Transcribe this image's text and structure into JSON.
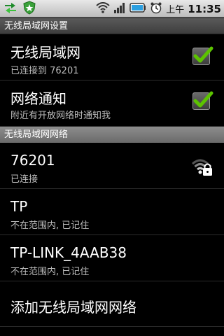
{
  "statusbar": {
    "ampm": "上午",
    "time": "11:35",
    "icons": [
      "usb-debug-icon",
      "shield-icon",
      "wifi-signal-icon",
      "cell-signal-icon",
      "battery-icon",
      "alarm-icon"
    ]
  },
  "titlebar": {
    "title": "无线局域网设置"
  },
  "settings": {
    "wifi": {
      "title": "无线局域网",
      "summary": "已连接到 76201",
      "checked": true
    },
    "notify": {
      "title": "网络通知",
      "summary": "附近有开放网络时通知我",
      "checked": true
    }
  },
  "networks_header": "无线局域网网络",
  "networks": [
    {
      "ssid": "76201",
      "status": "已连接"
    },
    {
      "ssid": "TP",
      "status": "不在范围内, 已记住"
    },
    {
      "ssid": "TP-LINK_4AAB38",
      "status": "不在范围内, 已记住"
    }
  ],
  "add_network": "添加无线局域网网络",
  "colors": {
    "check": "#5cc300",
    "section_header": "#7a7a7a",
    "title_bar": "#4a4a4a"
  }
}
